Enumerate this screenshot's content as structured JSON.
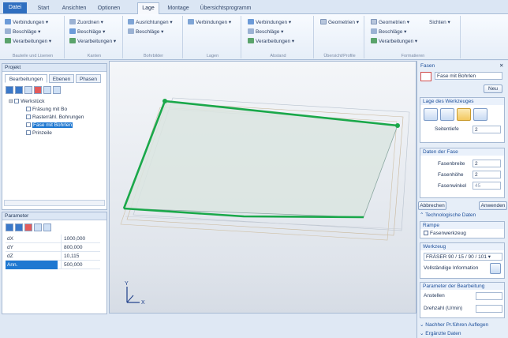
{
  "ribbon_tabs": [
    "Datei",
    "Start",
    "Ansichten",
    "Optionen",
    "Lage",
    "Montage",
    "Übersichtsprogramm"
  ],
  "active_tab_index": 4,
  "ribbon": {
    "groups": [
      {
        "items": [
          "Verbindungen",
          "Beschläge",
          "Verarbeitungen"
        ],
        "label": "Bauteile und Lisenen"
      },
      {
        "items": [
          "Zuordnen",
          "Beschläge",
          "Verarbeitungen"
        ],
        "label": "Kanten"
      },
      {
        "items": [
          "Ausrichtungen",
          "Beschläge"
        ],
        "label": "Bohrbilder"
      },
      {
        "items": [
          "Verbindungen"
        ],
        "label": "Lagen"
      },
      {
        "items": [
          "Verbindungen",
          "Beschläge",
          "Verarbeitungen"
        ],
        "label": "Abstand"
      },
      {
        "items": [
          "Geometrien"
        ],
        "label": "Übersicht/Profile"
      },
      {
        "items": [
          "Geometrien",
          "Beschläge",
          "Verarbeitungen"
        ],
        "label": "Formatieren"
      },
      {
        "items": [
          "Sichten"
        ],
        "label": ""
      }
    ]
  },
  "project_panel": {
    "title": "Projekt",
    "tabs": [
      "Bearbeitungen",
      "Ebenen",
      "Phasen"
    ],
    "tree": [
      {
        "label": "Werkstück",
        "level": 0,
        "selected": false
      },
      {
        "label": "Fräsung mit Bo",
        "level": 1,
        "selected": false
      },
      {
        "label": "Rasterrähl. Bohrungen",
        "level": 1,
        "selected": false
      },
      {
        "label": "Fase mit Bohrlen",
        "level": 1,
        "selected": true
      },
      {
        "label": "Prinzeile",
        "level": 1,
        "selected": false
      }
    ]
  },
  "parameter_panel": {
    "title": "Parameter",
    "rows": [
      {
        "key": "dX",
        "value": "1000,000"
      },
      {
        "key": "dY",
        "value": "800,000"
      },
      {
        "key": "dZ",
        "value": "10,115"
      },
      {
        "key": "Ann.",
        "value": "500,000",
        "selected": true
      }
    ]
  },
  "right_panel": {
    "title": "Fasen",
    "close_glyph": "✕",
    "name_field": "Fase mit Bohrlen",
    "neu_button": "Neu",
    "lage_section": "Lage des Werkzeuges",
    "seitentiefe_label": "Seitentiefe",
    "seitentiefe_value": "2",
    "fase_section": "Daten der Fase",
    "fase_rows": [
      {
        "label": "Fasenbreite",
        "value": "2"
      },
      {
        "label": "Fasenhöhe",
        "value": "2"
      },
      {
        "label": "Fasenwinkel",
        "value": "45"
      }
    ],
    "abbrechen": "Abbrechen",
    "anwenden": "Anwenden",
    "technologische": "Technologische Daten",
    "rampe_header": "Rampe",
    "fasenwerkzeug": "Fasenwerkzeug",
    "werkzeug_header": "Werkzeug",
    "werkzeug_value": "FRÄSER 90 / 15 / 90 / 101",
    "vollstaendige": "Vollständige Information",
    "parameter_header": "Parameter der Bearbeitung",
    "anstellwinkel": "Anstellen",
    "drehzahl": "Drehzahl (U/min)",
    "fertige_label": "Nachher Pr.führen Auflegen",
    "ergaenzte_label": "Ergänzte Daten"
  },
  "viewport": {
    "axis_label_x": "X",
    "axis_label_y": "Y"
  },
  "colors": {
    "accent": "#1f78d1",
    "edge_highlight": "#1aa84a",
    "ribbon_bg": "#e6eef8"
  }
}
